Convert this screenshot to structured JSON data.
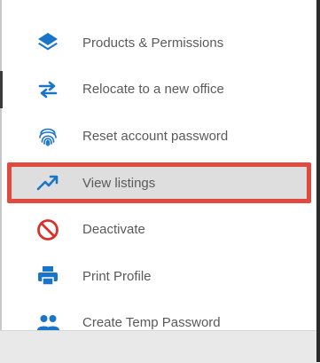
{
  "menu": {
    "items": [
      {
        "label": "Products & Permissions",
        "icon": "layers-icon"
      },
      {
        "label": "Relocate to a new office",
        "icon": "swap-arrows-icon"
      },
      {
        "label": "Reset account password",
        "icon": "fingerprint-icon"
      },
      {
        "label": "View listings",
        "icon": "trending-up-icon",
        "selected": true
      },
      {
        "label": "Deactivate",
        "icon": "prohibited-icon"
      },
      {
        "label": "Print Profile",
        "icon": "printer-icon"
      },
      {
        "label": "Create Temp Password",
        "icon": "users-icon"
      }
    ]
  },
  "colors": {
    "icon_blue": "#1a75c9",
    "deactivate_red": "#d9322b",
    "highlight_border": "#e04a3f",
    "highlight_fill": "#dedede",
    "label_text": "#5a5a5a"
  }
}
